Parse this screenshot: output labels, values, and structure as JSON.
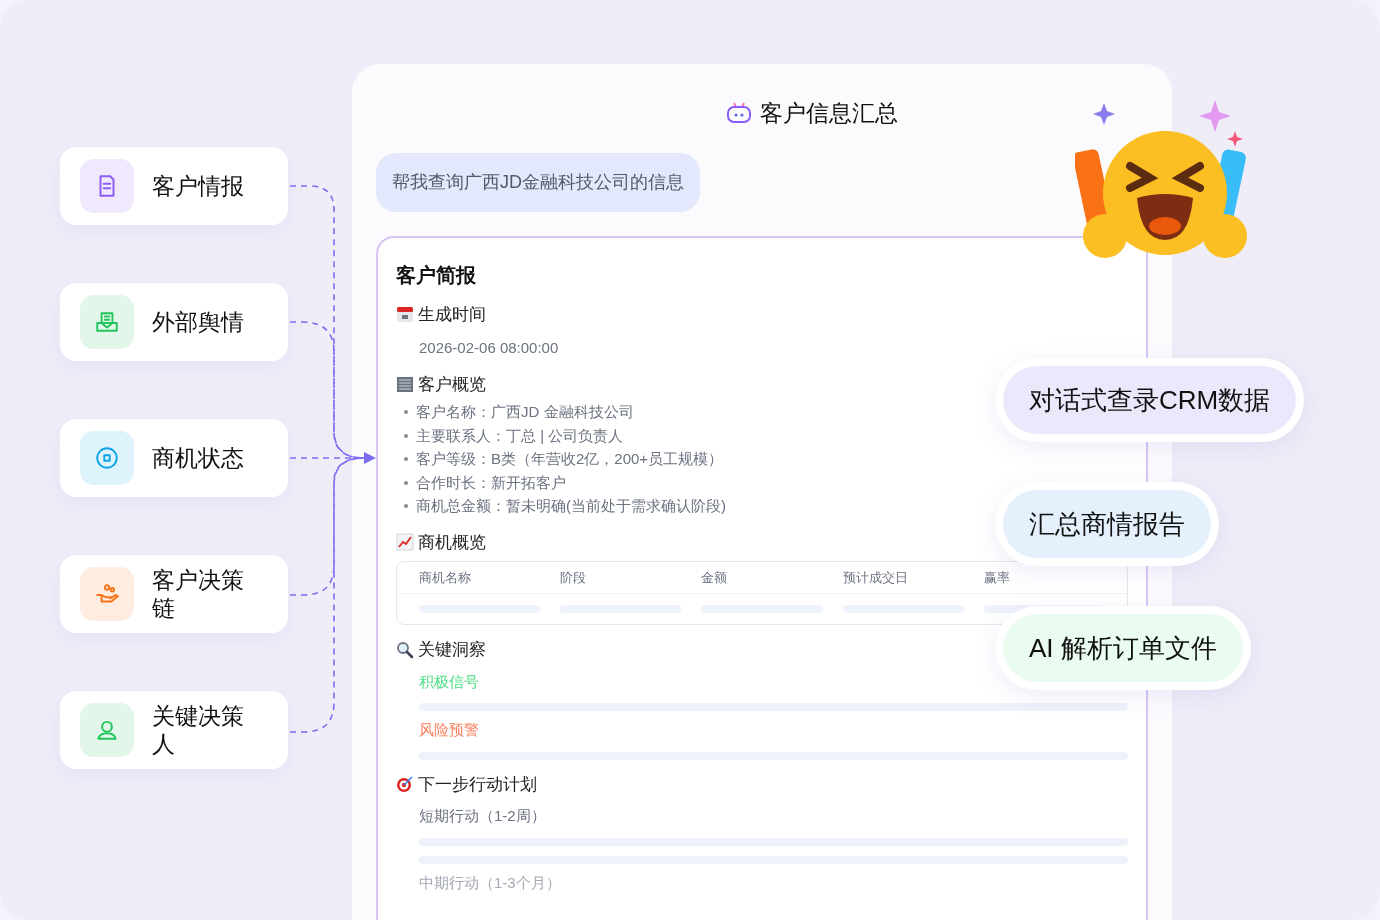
{
  "sources": [
    {
      "label": "客户情报",
      "color": "#8b5cf6"
    },
    {
      "label": "外部舆情",
      "color": "#22c55e"
    },
    {
      "label": "商机状态",
      "color": "#0ea5e9"
    },
    {
      "label": "客户决策链",
      "color": "#f97316"
    },
    {
      "label": "关键决策人",
      "color": "#22c55e"
    }
  ],
  "chat": {
    "title": "客户信息汇总",
    "query": "帮我查询广西JD金融科技公司的信息"
  },
  "report": {
    "title": "客户简报",
    "sections": [
      {
        "kind": "text",
        "heading": "生成时间",
        "value": "2026-02-06  08:00:00"
      },
      {
        "kind": "list",
        "heading": "客户概览",
        "items": [
          "客户名称：广西JD 金融科技公司",
          "主要联系人：丁总 | 公司负责人",
          "客户等级：B类（年营收2亿，200+员工规模）",
          "合作时长：新开拓客户",
          "商机总金额：暂未明确(当前处于需求确认阶段)"
        ]
      },
      {
        "kind": "table",
        "heading": "商机概览",
        "columns": [
          "商机名称",
          "阶段",
          "金额",
          "预计成交日",
          "赢率"
        ]
      },
      {
        "kind": "labels",
        "heading": "关键洞察",
        "items": [
          {
            "label": "积极信号",
            "color": "#4ade80"
          },
          {
            "label": "风险预警",
            "color": "#fb7d5b"
          }
        ]
      },
      {
        "kind": "labels",
        "heading": "下一步行动计划",
        "items": [
          {
            "label": "短期行动（1-2周）",
            "color": "#6b7280"
          },
          {
            "label": "中期行动（1-3个月）",
            "color": "#a3a8b2"
          }
        ]
      }
    ]
  },
  "features": [
    {
      "label": "对话式查录CRM数据",
      "color": "#ece8fb"
    },
    {
      "label": "汇总商情报告",
      "color": "#e4f1fd"
    },
    {
      "label": "AI 解析订单文件",
      "color": "#eafcef"
    }
  ]
}
